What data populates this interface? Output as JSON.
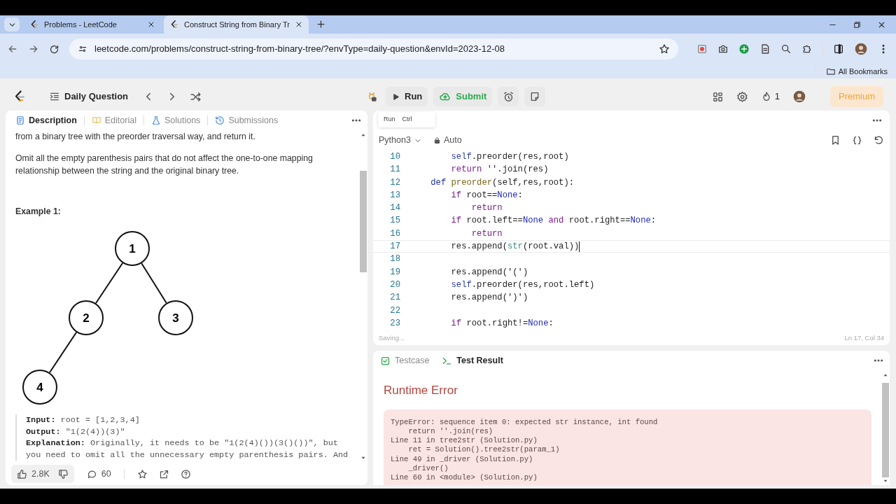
{
  "browser": {
    "tabs": [
      {
        "title": "Problems - LeetCode",
        "selected": false
      },
      {
        "title": "Construct String from Binary Tr",
        "selected": true
      }
    ],
    "url": "leetcode.com/problems/construct-string-from-binary-tree/?envType=daily-question&envId=2023-12-08",
    "bookmarks_label": "All Bookmarks"
  },
  "toolbar": {
    "problem_list": "Daily Question",
    "run": "Run",
    "submit": "Submit",
    "streak": "1",
    "premium": "Premium"
  },
  "description": {
    "tabs": [
      {
        "label": "Description",
        "selected": true
      },
      {
        "label": "Editorial",
        "selected": false
      },
      {
        "label": "Solutions",
        "selected": false
      },
      {
        "label": "Submissions",
        "selected": false
      }
    ],
    "paragraphs": [
      "from a binary tree with the preorder traversal way, and return it.",
      "Omit all the empty parenthesis pairs that do not affect the one-to-one mapping relationship between the string and the original binary tree."
    ],
    "example_title": "Example 1:",
    "tree": {
      "value": "1",
      "children": [
        {
          "value": "2",
          "children": [
            {
              "value": "4"
            }
          ]
        },
        {
          "value": "3"
        }
      ]
    },
    "example": [
      {
        "label": "Input:",
        "text": "root = [1,2,3,4]"
      },
      {
        "label": "Output:",
        "text": "\"1(2(4))(3)\""
      },
      {
        "label": "Explanation:",
        "text": "Originally, it needs to be \"1(2(4)())(3()())\", but you need to omit all the unnecessary empty parenthesis pairs. And"
      }
    ],
    "footer": {
      "likes": "2.8K",
      "comments": "60"
    }
  },
  "editor": {
    "tooltip": {
      "label": "Run",
      "shortcut": "Ctrl"
    },
    "language": "Python3",
    "mode": "Auto",
    "lines": [
      {
        "number": "10",
        "active": false,
        "tokens": [
          {
            "text": "        self",
            "kind": "self"
          },
          {
            "text": ".preorder(res,root)",
            "kind": "plain"
          }
        ]
      },
      {
        "number": "11",
        "active": false,
        "tokens": [
          {
            "text": "        return",
            "kind": "keyword"
          },
          {
            "text": " ''.join(res)",
            "kind": "plain"
          }
        ]
      },
      {
        "number": "12",
        "active": false,
        "tokens": [
          {
            "text": "    def",
            "kind": "def"
          },
          {
            "text": " preorder",
            "kind": "defname"
          },
          {
            "text": "(self,res,root):",
            "kind": "plain"
          }
        ]
      },
      {
        "number": "13",
        "active": false,
        "tokens": [
          {
            "text": "        if",
            "kind": "keyword"
          },
          {
            "text": " root==",
            "kind": "plain"
          },
          {
            "text": "None",
            "kind": "constant"
          },
          {
            "text": ":",
            "kind": "plain"
          }
        ]
      },
      {
        "number": "14",
        "active": false,
        "tokens": [
          {
            "text": "            return",
            "kind": "keyword"
          }
        ]
      },
      {
        "number": "15",
        "active": false,
        "tokens": [
          {
            "text": "        if",
            "kind": "keyword"
          },
          {
            "text": " root.left==",
            "kind": "plain"
          },
          {
            "text": "None",
            "kind": "constant"
          },
          {
            "text": " and",
            "kind": "keyword"
          },
          {
            "text": " root.right==",
            "kind": "plain"
          },
          {
            "text": "None",
            "kind": "constant"
          },
          {
            "text": ":",
            "kind": "plain"
          }
        ]
      },
      {
        "number": "16",
        "active": false,
        "tokens": [
          {
            "text": "            return",
            "kind": "keyword"
          }
        ]
      },
      {
        "number": "17",
        "active": true,
        "tokens": [
          {
            "text": "        res.append(",
            "kind": "plain"
          },
          {
            "text": "str",
            "kind": "builtin"
          },
          {
            "text": "(root.val))",
            "kind": "plain"
          }
        ]
      },
      {
        "number": "18",
        "active": false
      },
      {
        "number": "19",
        "active": false,
        "tokens": [
          {
            "text": "        res.append('(')",
            "kind": "plain"
          }
        ]
      },
      {
        "number": "20",
        "active": false,
        "tokens": [
          {
            "text": "        self",
            "kind": "self"
          },
          {
            "text": ".preorder(res,root.left)",
            "kind": "plain"
          }
        ]
      },
      {
        "number": "21",
        "active": false,
        "tokens": [
          {
            "text": "        res.append(')')",
            "kind": "plain"
          }
        ]
      },
      {
        "number": "22",
        "active": false
      },
      {
        "number": "23",
        "active": false,
        "tokens": [
          {
            "text": "        if",
            "kind": "keyword"
          },
          {
            "text": " root.right!=",
            "kind": "plain"
          },
          {
            "text": "None",
            "kind": "constant"
          },
          {
            "text": ":",
            "kind": "plain"
          }
        ]
      }
    ],
    "status": "Saving...",
    "position": "Ln 17, Col 34"
  },
  "result": {
    "tabs": [
      {
        "label": "Testcase",
        "kind": "testcase",
        "selected": false
      },
      {
        "label": "Test Result",
        "kind": "result",
        "selected": true
      }
    ],
    "title": "Runtime Error",
    "error_lines": [
      "TypeError: sequence item 0: expected str instance, int found",
      "    return ''.join(res)",
      "Line 11 in tree2str (Solution.py)",
      "    ret = Solution().tree2str(param_1)",
      "Line 49 in _driver (Solution.py)",
      "    _driver()",
      "Line 60 in <module> (Solution.py)"
    ]
  }
}
